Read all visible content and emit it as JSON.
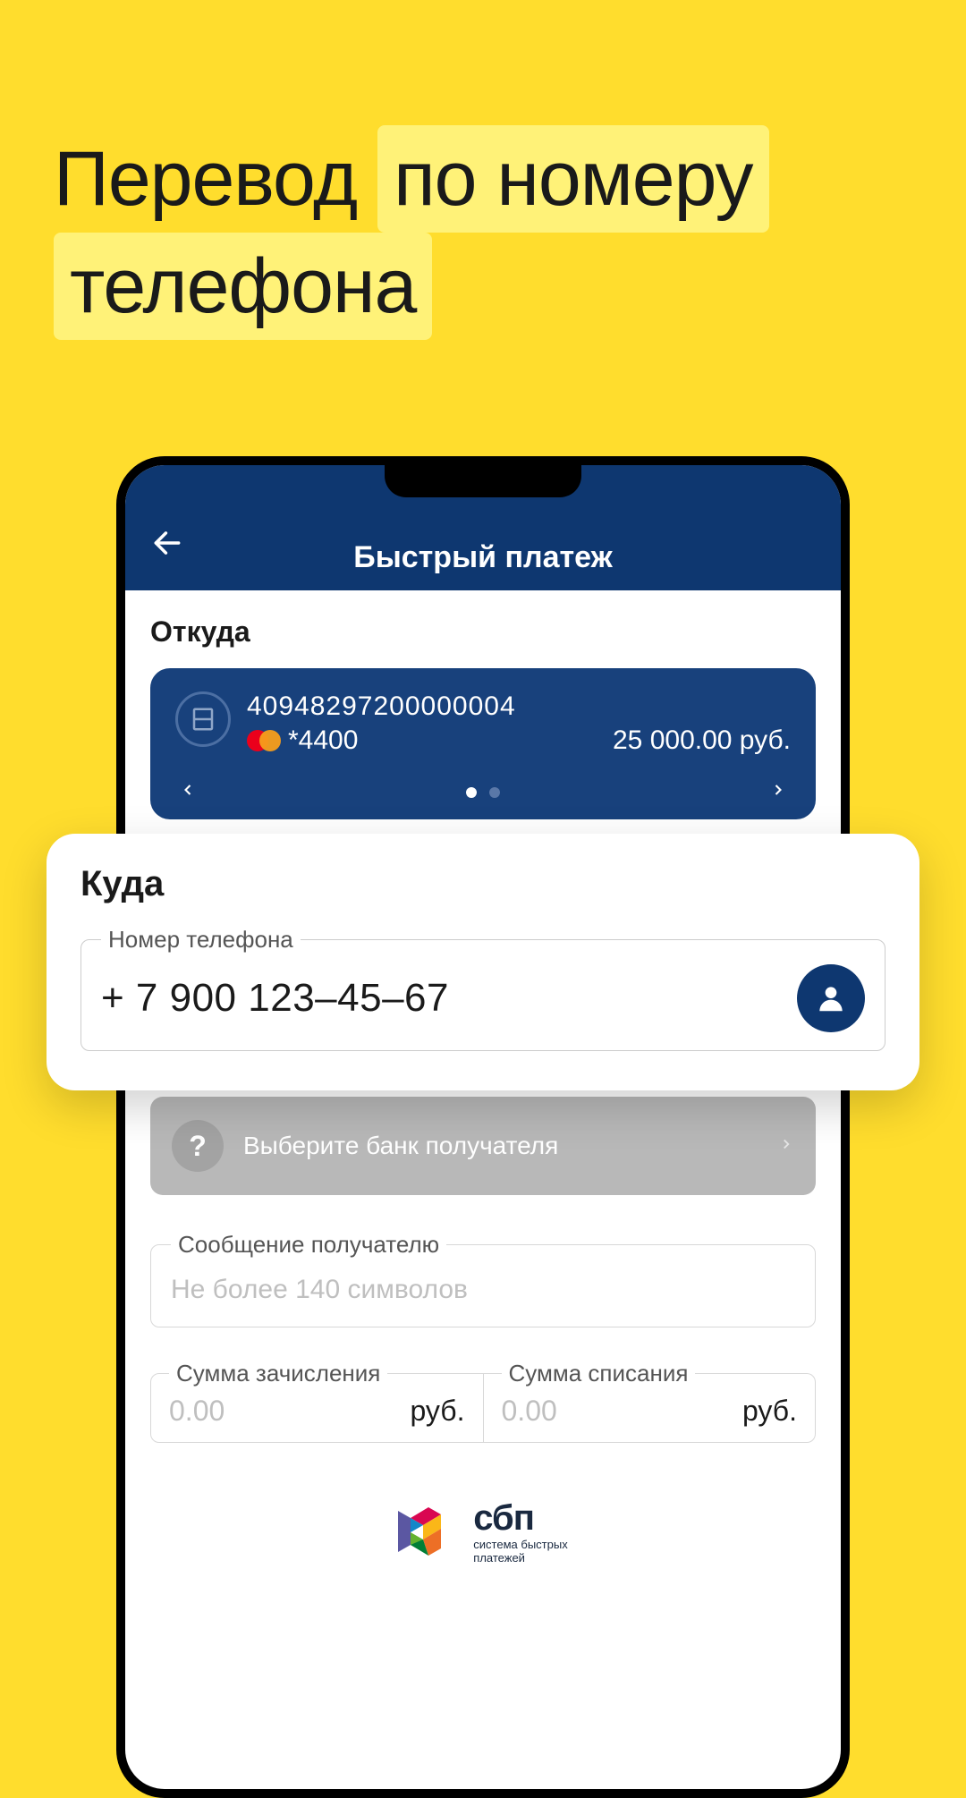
{
  "hero": {
    "lead": "Перевод",
    "hl1": "по номеру",
    "hl2": "телефона"
  },
  "header": {
    "title": "Быстрый платеж"
  },
  "from": {
    "label": "Откуда",
    "card_number": "40948297200000004",
    "card_mask": "*4400",
    "balance": "25 000.00 руб."
  },
  "to": {
    "label": "Куда",
    "phone_legend": "Номер телефона",
    "phone_value": "+ 7 900 123–45–67"
  },
  "bank_select": "Выберите банк получателя",
  "message": {
    "legend": "Сообщение получателю",
    "placeholder": "Не более 140 символов"
  },
  "amount_in": {
    "legend": "Сумма зачисления",
    "placeholder": "0.00",
    "unit": "руб."
  },
  "amount_out": {
    "legend": "Сумма списания",
    "placeholder": "0.00",
    "unit": "руб."
  },
  "sbp": {
    "name": "сбп",
    "desc1": "система быстрых",
    "desc2": "платежей"
  }
}
